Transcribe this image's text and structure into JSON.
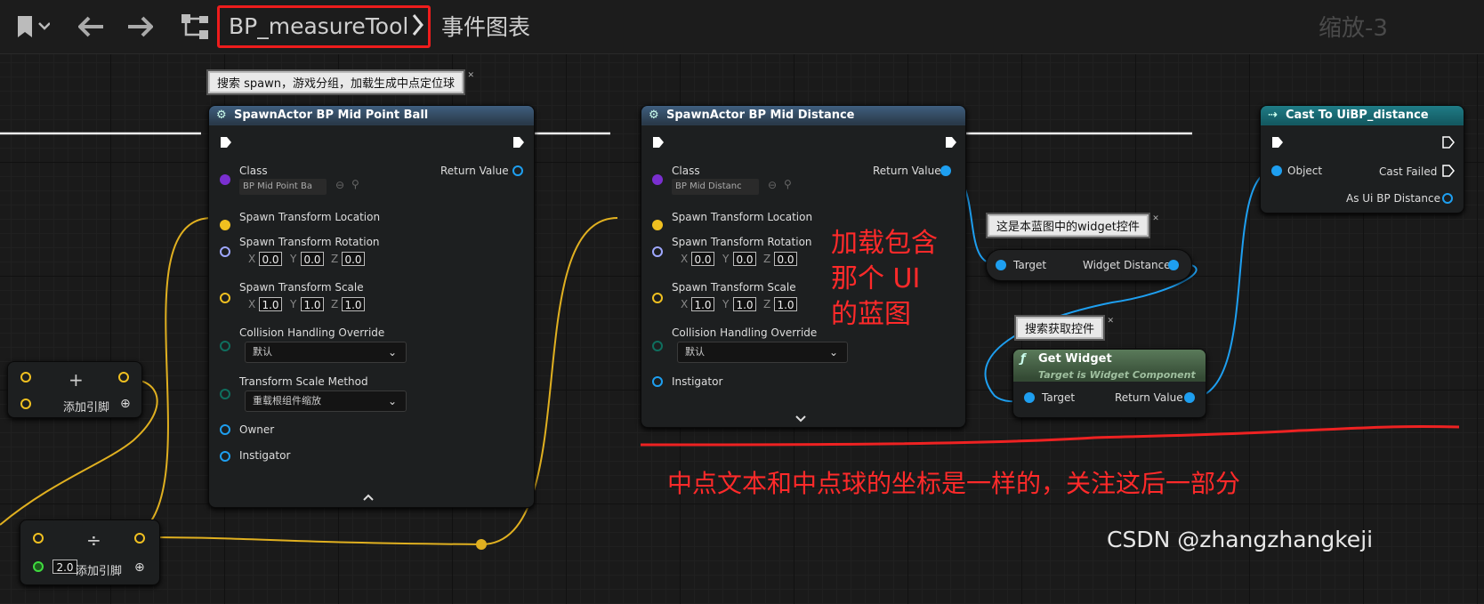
{
  "toolbar": {
    "breadcrumb_asset": "BP_measureTool",
    "graph_name": "事件图表",
    "zoom_label": "缩放-3"
  },
  "comments": {
    "spawn_note": "搜索 spawn，游戏分组，加载生成中点定位球",
    "widget_note": "这是本蓝图中的widget控件",
    "get_widget_note": "搜索获取控件"
  },
  "node_spawn_ball": {
    "title": "SpawnActor BP Mid Point Ball",
    "class_label": "Class",
    "class_value": "BP Mid Point Ba",
    "return_value": "Return Value",
    "location": "Spawn Transform Location",
    "rotation": "Spawn Transform Rotation",
    "rotation_values": [
      "0.0",
      "0.0",
      "0.0"
    ],
    "scale": "Spawn Transform Scale",
    "scale_values": [
      "1.0",
      "1.0",
      "1.0"
    ],
    "collision": "Collision Handling Override",
    "collision_value": "默认",
    "scale_method": "Transform Scale Method",
    "scale_method_value": "重载根组件缩放",
    "owner": "Owner",
    "instigator": "Instigator"
  },
  "node_spawn_distance": {
    "title": "SpawnActor BP Mid Distance",
    "class_label": "Class",
    "class_value": "BP Mid Distanc",
    "return_value": "Return Value",
    "location": "Spawn Transform Location",
    "rotation": "Spawn Transform Rotation",
    "rotation_values": [
      "0.0",
      "0.0",
      "0.0"
    ],
    "scale": "Spawn Transform Scale",
    "scale_values": [
      "1.0",
      "1.0",
      "1.0"
    ],
    "collision": "Collision Handling Override",
    "collision_value": "默认",
    "instigator": "Instigator"
  },
  "node_cast": {
    "title": "Cast To UiBP_distance",
    "object": "Object",
    "cast_failed": "Cast Failed",
    "as_result": "As Ui BP Distance"
  },
  "node_widget_var": {
    "target": "Target",
    "output": "Widget Distance"
  },
  "node_get_widget": {
    "title": "Get Widget",
    "subtitle": "Target is Widget Component",
    "target": "Target",
    "return_value": "Return Value"
  },
  "node_add": {
    "symbol": "+",
    "add_pin": "添加引脚"
  },
  "node_divide": {
    "symbol": "÷",
    "input_value": "2.0",
    "add_pin": "添加引脚"
  },
  "axis_labels": [
    "X",
    "Y",
    "Z"
  ],
  "annotations": {
    "blueprint_note_line1": "加载包含",
    "blueprint_note_line2": "那个 UI",
    "blueprint_note_line3": "的蓝图",
    "bottom_note": "中点文本和中点球的坐标是一样的，关注这后一部分"
  },
  "watermark": "CSDN @zhangzhangkeji",
  "colors": {
    "annotation_red": "#ff2a2a",
    "vector_pin": "#f0c020",
    "object_pin": "#1e9ff0",
    "rotator_pin": "#9fa8ff",
    "class_pin": "#7a2fd0",
    "enum_pin": "#0f6e5e",
    "float_pin": "#3fdc3f"
  }
}
